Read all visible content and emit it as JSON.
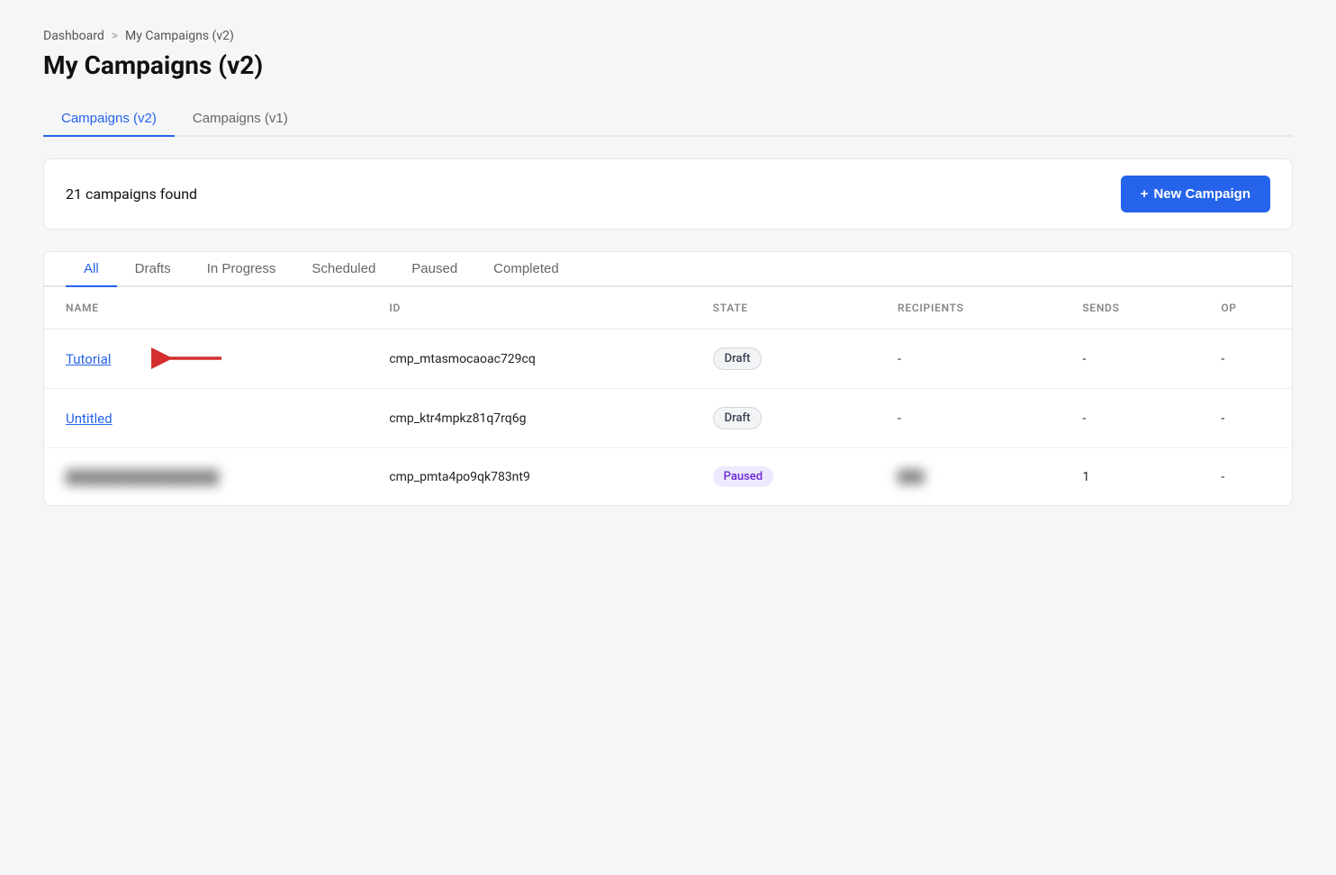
{
  "breadcrumb": {
    "home": "Dashboard",
    "separator": ">",
    "current": "My Campaigns (v2)"
  },
  "page_title": "My Campaigns (v2)",
  "version_tabs": [
    {
      "label": "Campaigns (v2)",
      "active": true
    },
    {
      "label": "Campaigns (v1)",
      "active": false
    }
  ],
  "toolbar": {
    "count_text": "21 campaigns found",
    "new_button_icon": "+",
    "new_button_label": "New Campaign"
  },
  "filter_tabs": [
    {
      "label": "All",
      "active": true
    },
    {
      "label": "Drafts",
      "active": false
    },
    {
      "label": "In Progress",
      "active": false
    },
    {
      "label": "Scheduled",
      "active": false
    },
    {
      "label": "Paused",
      "active": false
    },
    {
      "label": "Completed",
      "active": false
    }
  ],
  "table": {
    "columns": [
      "NAME",
      "ID",
      "STATE",
      "RECIPIENTS",
      "SENDS",
      "OP"
    ],
    "rows": [
      {
        "name": "Tutorial",
        "id": "cmp_mtasmocaoac729cq",
        "state": "Draft",
        "state_type": "draft",
        "recipients": "-",
        "sends": "-",
        "op": "-",
        "has_arrow": true
      },
      {
        "name": "Untitled",
        "id": "cmp_ktr4mpkz81q7rq6g",
        "state": "Draft",
        "state_type": "draft",
        "recipients": "-",
        "sends": "-",
        "op": "-",
        "has_arrow": false
      },
      {
        "name": "████████████████",
        "id": "cmp_pmta4po9qk783nt9",
        "state": "Paused",
        "state_type": "paused",
        "recipients": "███",
        "sends": "1",
        "op": "-",
        "has_arrow": false,
        "blurred_name": true,
        "blurred_recipients": true
      }
    ]
  }
}
